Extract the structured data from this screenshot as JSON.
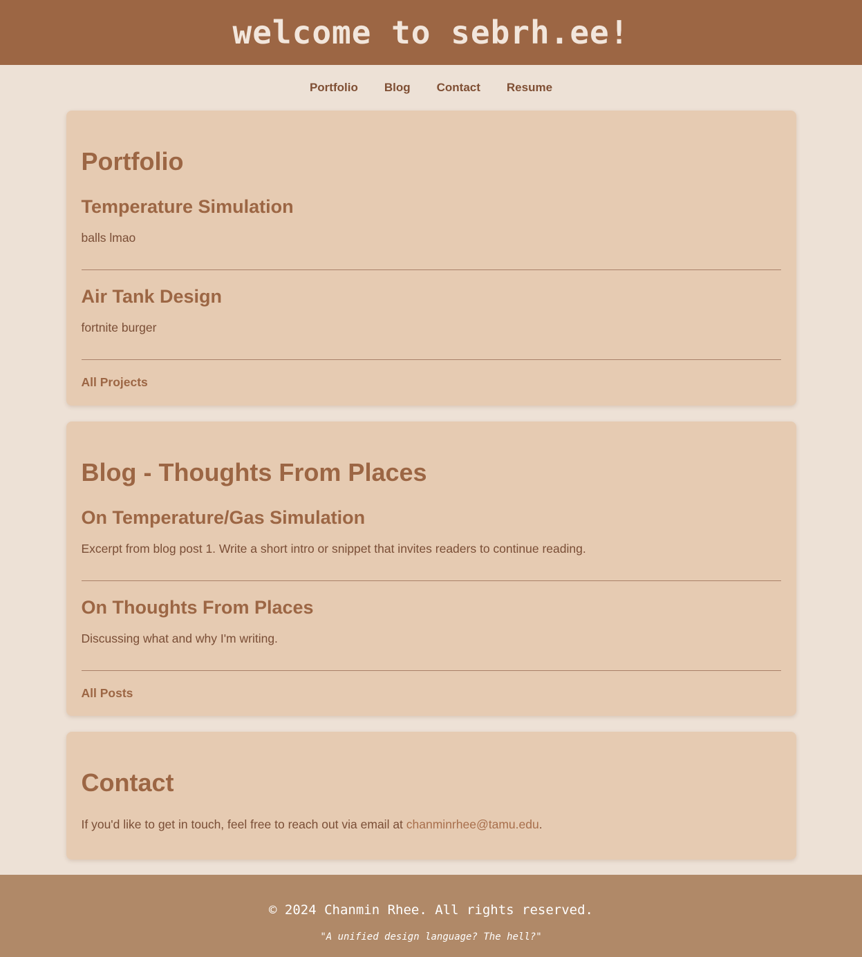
{
  "header": {
    "title": "welcome to sebrh.ee!"
  },
  "nav": {
    "items": [
      {
        "label": "Portfolio"
      },
      {
        "label": "Blog"
      },
      {
        "label": "Contact"
      },
      {
        "label": "Resume"
      }
    ]
  },
  "portfolio": {
    "title": "Portfolio",
    "projects": [
      {
        "title": "Temperature Simulation",
        "description": "balls lmao"
      },
      {
        "title": "Air Tank Design",
        "description": "fortnite burger"
      }
    ],
    "all_link": "All Projects"
  },
  "blog": {
    "title": "Blog - Thoughts From Places",
    "posts": [
      {
        "title": "On Temperature/Gas Simulation",
        "excerpt": "Excerpt from blog post 1. Write a short intro or snippet that invites readers to continue reading."
      },
      {
        "title": "On Thoughts From Places",
        "excerpt": "Discussing what and why I'm writing."
      }
    ],
    "all_link": "All Posts"
  },
  "contact": {
    "title": "Contact",
    "text_before": "If you'd like to get in touch, feel free to reach out via email at ",
    "email": "chanminrhee@tamu.edu",
    "text_after": "."
  },
  "footer": {
    "copyright": "© 2024 Chanmin Rhee. All rights reserved.",
    "quote": "\"A unified design language? The hell?\""
  },
  "colors": {
    "header_bg": "#9c6644",
    "page_bg": "#ede1d6",
    "card_bg": "#e6cbb2",
    "accent": "#9c6644",
    "footer_bg": "#b08968"
  }
}
